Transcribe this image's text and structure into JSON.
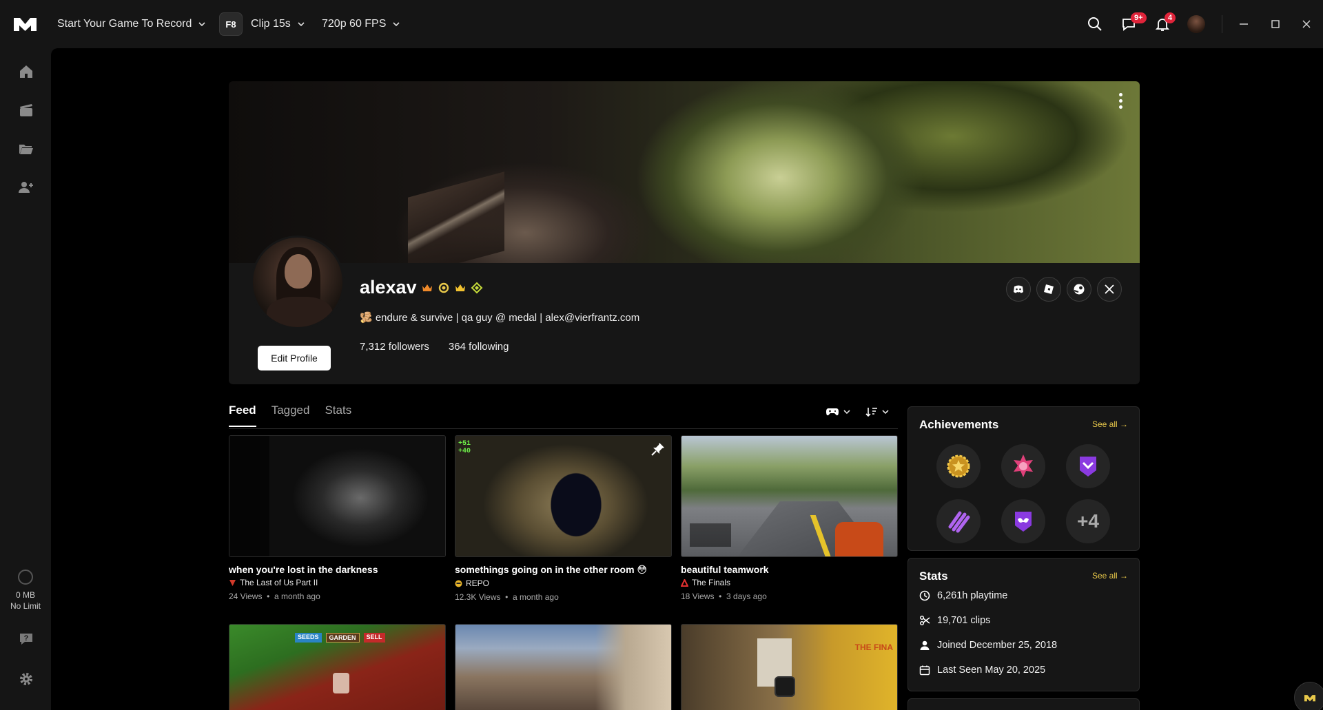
{
  "titlebar": {
    "game_label": "Start Your Game To Record",
    "hotkey": "F8",
    "clip_label": "Clip 15s",
    "quality_label": "720p 60 FPS",
    "messages_badge": "9+",
    "notifications_badge": "4"
  },
  "sidebar": {
    "storage_used": "0 MB",
    "storage_limit": "No Limit"
  },
  "profile": {
    "username": "alexav",
    "bio": "🫚 endure & survive | qa guy @ medal | alex@vierfrantz.com",
    "followers": "7,312 followers",
    "following": "364 following",
    "edit_label": "Edit Profile"
  },
  "tabs": [
    "Feed",
    "Tagged",
    "Stats"
  ],
  "clips": [
    {
      "title": "when you're lost in the darkness",
      "game": "The Last of Us Part II",
      "views": "24 Views",
      "age": "a month ago"
    },
    {
      "title": "somethings going on in the other room 😳",
      "game": "REPO",
      "views": "12.3K Views",
      "age": "a month ago"
    },
    {
      "title": "beautiful teamwork",
      "game": "The Finals",
      "views": "18 Views",
      "age": "3 days ago"
    }
  ],
  "clip_row2": {
    "labels": [
      "SEEDS",
      "GARDEN",
      "SELL"
    ],
    "tag": "THE FINA"
  },
  "achievements": {
    "title": "Achievements",
    "see_all": "See all →",
    "more": "+4"
  },
  "stats": {
    "title": "Stats",
    "see_all": "See all →",
    "playtime": "6,261h playtime",
    "clips": "19,701 clips",
    "joined": "Joined December 25, 2018",
    "last_seen": "Last Seen May 20, 2025"
  },
  "colors": {
    "accent": "#e8c84a",
    "badge": "#e0243a",
    "background": "#000000",
    "panel": "#161616"
  }
}
